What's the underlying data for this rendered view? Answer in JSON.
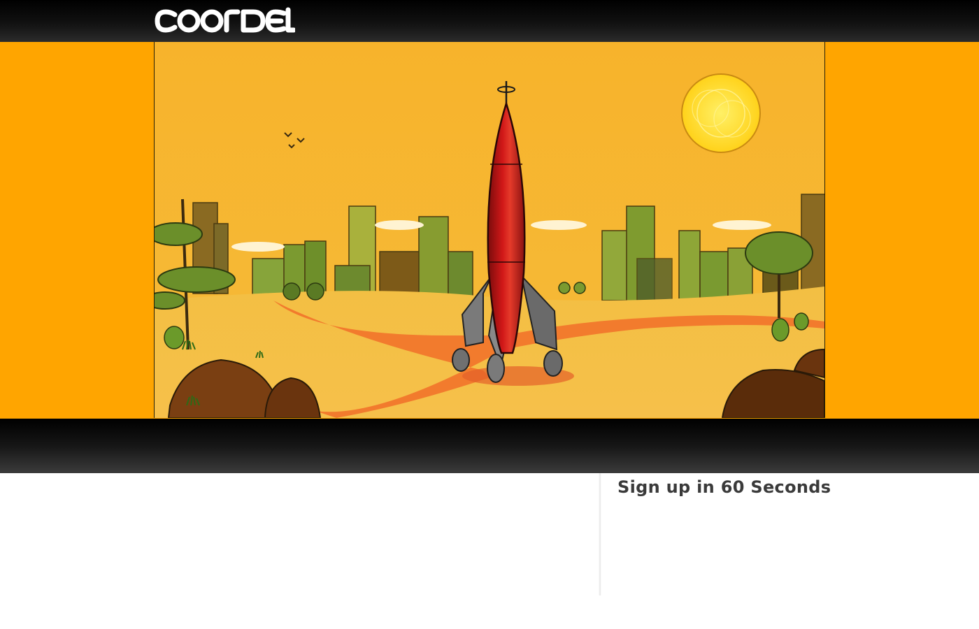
{
  "header": {
    "logo_text": "coordel"
  },
  "hero": {
    "scene": "rocket-launch-illustration"
  },
  "signup": {
    "heading": "Sign up in 60 Seconds"
  },
  "colors": {
    "brand_orange": "#ffa500",
    "header_black": "#000000",
    "heading_text": "#3a3a3a"
  }
}
